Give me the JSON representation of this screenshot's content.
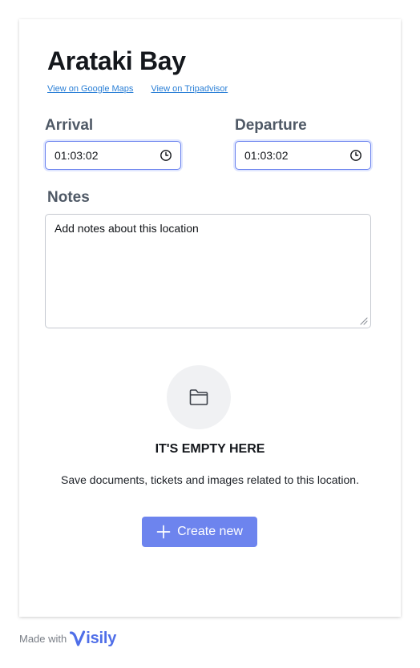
{
  "location": {
    "title": "Arataki Bay",
    "links": {
      "google_maps": "View on Google Maps",
      "tripadvisor": "View on Tripadvisor"
    }
  },
  "arrival": {
    "label": "Arrival",
    "value": "01:03:02",
    "icon": "clock-icon"
  },
  "departure": {
    "label": "Departure",
    "value": "01:03:02",
    "icon": "clock-icon"
  },
  "notes": {
    "label": "Notes",
    "placeholder": "Add notes about this location",
    "value": ""
  },
  "empty_state": {
    "icon": "folder-icon",
    "title": "IT'S EMPTY HERE",
    "description": "Save documents, tickets and images related to this location.",
    "button_label": "Create new",
    "button_icon": "plus-icon"
  },
  "footer": {
    "made_with": "Made with",
    "brand_rest": "isily",
    "brand_logo": "visily-v-logo"
  },
  "colors": {
    "accent": "#6d84ee",
    "link": "#2a7fd6",
    "label": "#4f5966",
    "input_focus_border": "#6a82ee",
    "brand": "#4f6ee8"
  }
}
